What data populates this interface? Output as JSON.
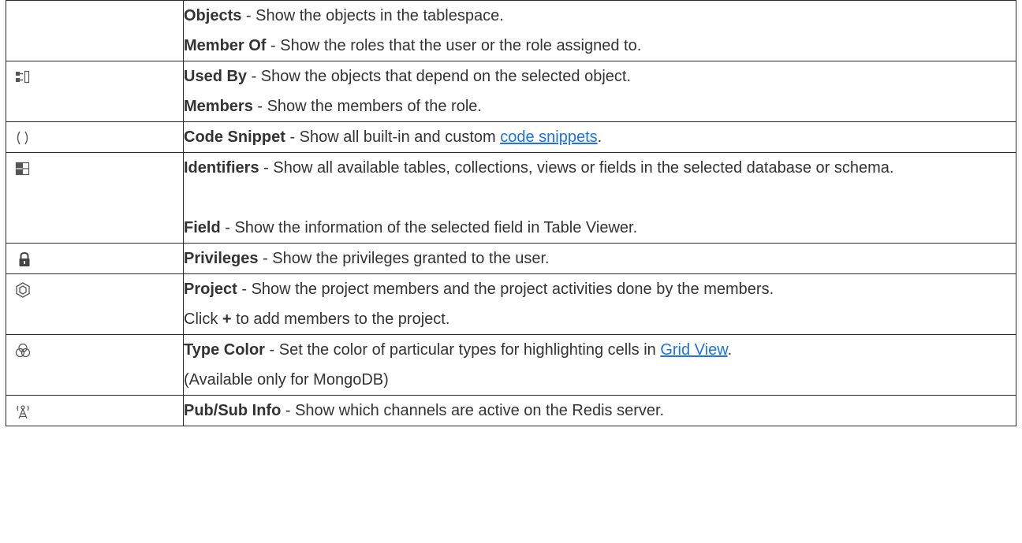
{
  "rows": [
    {
      "icon": "",
      "lines": [
        {
          "term": "Objects",
          "text": " - Show the objects in the tablespace."
        },
        {
          "term": "Member Of",
          "text": " - Show the roles that the user or the role assigned to."
        }
      ]
    },
    {
      "icon": "used-by-icon",
      "lines": [
        {
          "term": "Used By",
          "text": " - Show the objects that depend on the selected object."
        },
        {
          "term": "Members",
          "text": " - Show the members of the role."
        }
      ]
    },
    {
      "icon": "parentheses-icon",
      "lines": [
        {
          "term": "Code Snippet",
          "text": " - Show all built-in and custom ",
          "link": "code snippets",
          "after": "."
        }
      ]
    },
    {
      "icon": "grid-icon",
      "lines": [
        {
          "term": "Identifiers",
          "text": " - Show all available tables, collections, views or fields in the selected database or schema."
        },
        {
          "term": "Field",
          "text": " - Show the information of the selected field in Table Viewer."
        }
      ]
    },
    {
      "icon": "lock-icon",
      "lines": [
        {
          "term": "Privileges",
          "text": " - Show the privileges granted to the user."
        }
      ]
    },
    {
      "icon": "hexagon-icon",
      "lines": [
        {
          "term": "Project",
          "text": " - Show the project members and the project activities done by the members."
        },
        {
          "pre": "Click ",
          "term": "+",
          "text": " to add members to the project."
        }
      ]
    },
    {
      "icon": "color-circles-icon",
      "lines": [
        {
          "term": "Type Color",
          "text": " - Set the color of particular types for highlighting cells in ",
          "link": "Grid View",
          "after": "."
        },
        {
          "text": "(Available only for MongoDB)"
        }
      ]
    },
    {
      "icon": "broadcast-tower-icon",
      "lines": [
        {
          "term": "Pub/Sub Info",
          "text": " - Show which channels are active on the Redis server."
        }
      ]
    }
  ],
  "colors": {
    "text": "#333333",
    "link": "#1a73e8",
    "border": "#2a2a2a",
    "icon": "#555555"
  }
}
